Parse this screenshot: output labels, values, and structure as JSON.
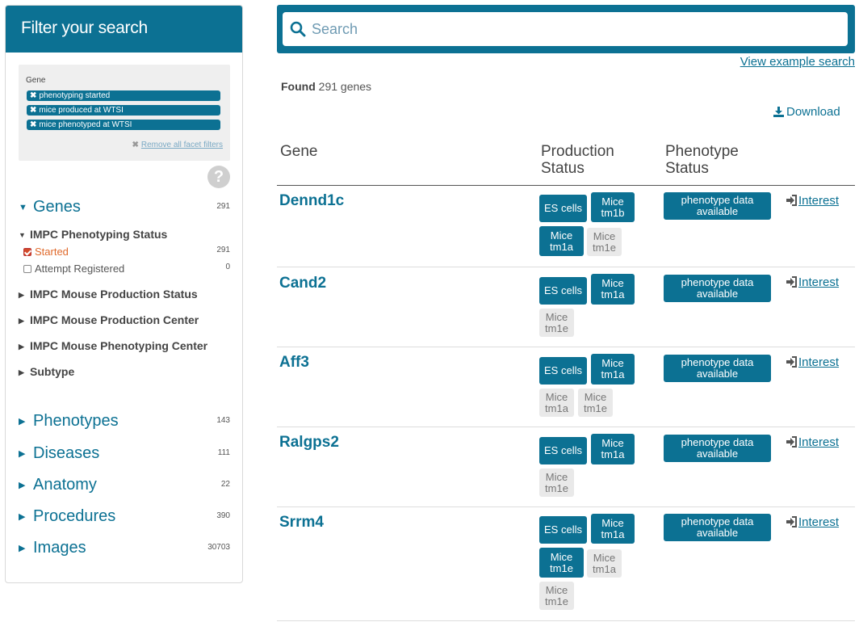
{
  "sidebar": {
    "title": "Filter your search",
    "filter_category": "Gene",
    "active_filters": [
      "phenotyping started",
      "mice produced at WTSI",
      "mice phenotyped at WTSI"
    ],
    "remove_all_label": "Remove all facet filters",
    "help_symbol": "?",
    "genes": {
      "label": "Genes",
      "count": "291"
    },
    "phenotyping_status": {
      "label": "IMPC Phenotyping Status",
      "options": [
        {
          "label": "Started",
          "count": "291",
          "checked": true
        },
        {
          "label": "Attempt Registered",
          "count": "0",
          "checked": false
        }
      ]
    },
    "sub_facets": [
      "IMPC Mouse Production Status",
      "IMPC Mouse Production Center",
      "IMPC Mouse Phenotyping Center",
      "Subtype"
    ],
    "categories": [
      {
        "label": "Phenotypes",
        "count": "143"
      },
      {
        "label": "Diseases",
        "count": "111"
      },
      {
        "label": "Anatomy",
        "count": "22"
      },
      {
        "label": "Procedures",
        "count": "390"
      },
      {
        "label": "Images",
        "count": "30703"
      }
    ]
  },
  "search": {
    "placeholder": "Search",
    "example_link": "View example search"
  },
  "results": {
    "found_prefix": "Found",
    "found_count": "291",
    "found_suffix": "genes",
    "download_label": "Download",
    "headers": {
      "gene": "Gene",
      "production_line1": "Production",
      "production_line2": "Status",
      "phenotype_line1": "Phenotype",
      "phenotype_line2": "Status"
    },
    "rows": [
      {
        "gene": "Dennd1c",
        "badges": [
          {
            "line1": "ES cells",
            "line2": "",
            "active": true
          },
          {
            "line1": "Mice",
            "line2": "tm1b",
            "active": true
          },
          {
            "line1": "Mice",
            "line2": "tm1a",
            "active": true
          },
          {
            "line1": "Mice",
            "line2": "tm1e",
            "active": false
          }
        ],
        "phenotype_line1": "phenotype data",
        "phenotype_line2": "available",
        "interest": "Interest"
      },
      {
        "gene": "Cand2",
        "badges": [
          {
            "line1": "ES cells",
            "line2": "",
            "active": true
          },
          {
            "line1": "Mice",
            "line2": "tm1a",
            "active": true
          },
          {
            "line1": "Mice",
            "line2": "tm1e",
            "active": false
          }
        ],
        "phenotype_line1": "phenotype data",
        "phenotype_line2": "available",
        "interest": "Interest"
      },
      {
        "gene": "Aff3",
        "badges": [
          {
            "line1": "ES cells",
            "line2": "",
            "active": true
          },
          {
            "line1": "Mice",
            "line2": "tm1a",
            "active": true
          },
          {
            "line1": "Mice",
            "line2": "tm1a",
            "active": false
          },
          {
            "line1": "Mice",
            "line2": "tm1e",
            "active": false
          }
        ],
        "phenotype_line1": "phenotype data",
        "phenotype_line2": "available",
        "interest": "Interest"
      },
      {
        "gene": "Ralgps2",
        "badges": [
          {
            "line1": "ES cells",
            "line2": "",
            "active": true
          },
          {
            "line1": "Mice",
            "line2": "tm1a",
            "active": true
          },
          {
            "line1": "Mice",
            "line2": "tm1e",
            "active": false
          }
        ],
        "phenotype_line1": "phenotype data",
        "phenotype_line2": "available",
        "interest": "Interest"
      },
      {
        "gene": "Srrm4",
        "badges": [
          {
            "line1": "ES cells",
            "line2": "",
            "active": true
          },
          {
            "line1": "Mice",
            "line2": "tm1a",
            "active": true
          },
          {
            "line1": "Mice",
            "line2": "tm1e",
            "active": true
          },
          {
            "line1": "Mice",
            "line2": "tm1a",
            "active": false
          },
          {
            "line1": "Mice",
            "line2": "tm1e",
            "active": false
          }
        ],
        "phenotype_line1": "phenotype data",
        "phenotype_line2": "available",
        "interest": "Interest"
      }
    ]
  },
  "colors": {
    "brand": "#0c7193",
    "inactive_badge": "#e9e9e9",
    "started_option": "#e06a2c"
  }
}
